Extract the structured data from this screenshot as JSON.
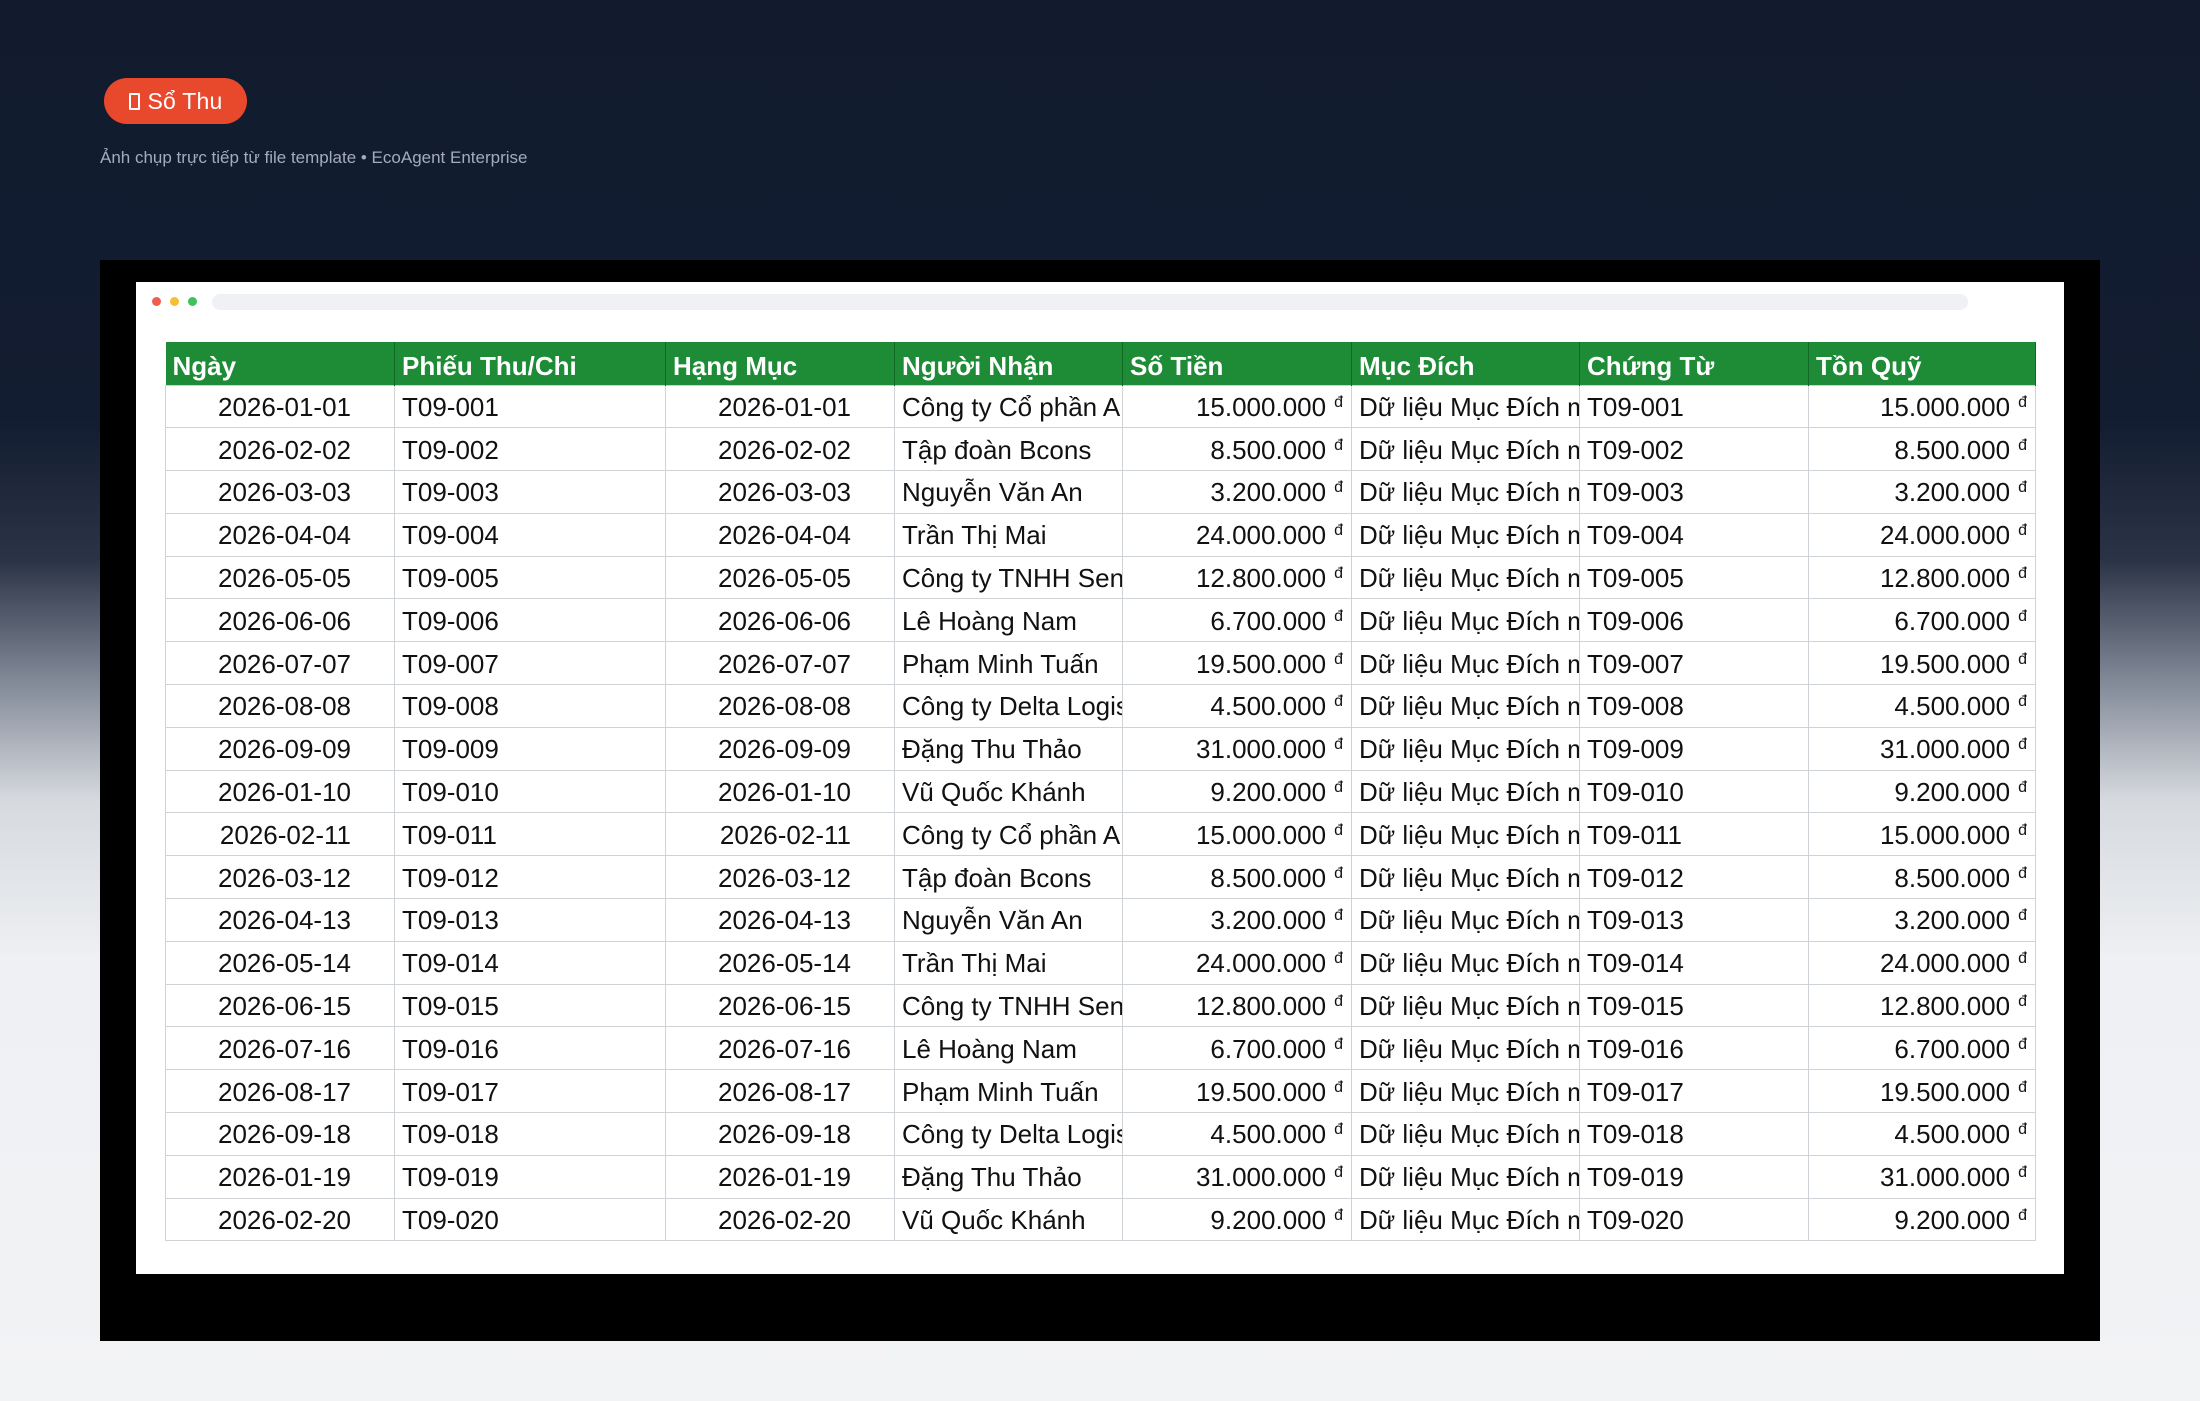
{
  "badge": {
    "icon": "book-icon",
    "label": "Sổ Thu"
  },
  "subtitle": "Ảnh chụp trực tiếp từ file template • EcoAgent Enterprise",
  "colors": {
    "badge": "#e8482c",
    "header": "#1e8b36",
    "frame": "#000000"
  },
  "table": {
    "currency_symbol": "đ",
    "headers": [
      "Ngày",
      "Phiếu Thu/Chi",
      "Hạng Mục",
      "Người Nhận",
      "Số Tiền",
      "Mục Đích",
      "Chứng Từ",
      "Tồn Quỹ"
    ],
    "rows": [
      [
        "2026-01-01",
        "T09-001",
        "2026-01-01",
        "Công ty Cổ phần A",
        "15.000.000",
        "Dữ liệu Mục Đích mẫu",
        "T09-001",
        "15.000.000"
      ],
      [
        "2026-02-02",
        "T09-002",
        "2026-02-02",
        "Tập đoàn Bcons",
        "8.500.000",
        "Dữ liệu Mục Đích mẫu",
        "T09-002",
        "8.500.000"
      ],
      [
        "2026-03-03",
        "T09-003",
        "2026-03-03",
        "Nguyễn Văn An",
        "3.200.000",
        "Dữ liệu Mục Đích mẫu",
        "T09-003",
        "3.200.000"
      ],
      [
        "2026-04-04",
        "T09-004",
        "2026-04-04",
        "Trần Thị Mai",
        "24.000.000",
        "Dữ liệu Mục Đích mẫu",
        "T09-004",
        "24.000.000"
      ],
      [
        "2026-05-05",
        "T09-005",
        "2026-05-05",
        "Công ty TNHH Sen",
        "12.800.000",
        "Dữ liệu Mục Đích mẫu",
        "T09-005",
        "12.800.000"
      ],
      [
        "2026-06-06",
        "T09-006",
        "2026-06-06",
        "Lê Hoàng Nam",
        "6.700.000",
        "Dữ liệu Mục Đích mẫu",
        "T09-006",
        "6.700.000"
      ],
      [
        "2026-07-07",
        "T09-007",
        "2026-07-07",
        "Phạm Minh Tuấn",
        "19.500.000",
        "Dữ liệu Mục Đích mẫu",
        "T09-007",
        "19.500.000"
      ],
      [
        "2026-08-08",
        "T09-008",
        "2026-08-08",
        "Công ty Delta Logistics",
        "4.500.000",
        "Dữ liệu Mục Đích mẫu",
        "T09-008",
        "4.500.000"
      ],
      [
        "2026-09-09",
        "T09-009",
        "2026-09-09",
        "Đặng Thu Thảo",
        "31.000.000",
        "Dữ liệu Mục Đích mẫu",
        "T09-009",
        "31.000.000"
      ],
      [
        "2026-01-10",
        "T09-010",
        "2026-01-10",
        "Vũ Quốc Khánh",
        "9.200.000",
        "Dữ liệu Mục Đích mẫu",
        "T09-010",
        "9.200.000"
      ],
      [
        "2026-02-11",
        "T09-011",
        "2026-02-11",
        "Công ty Cổ phần A",
        "15.000.000",
        "Dữ liệu Mục Đích mẫu",
        "T09-011",
        "15.000.000"
      ],
      [
        "2026-03-12",
        "T09-012",
        "2026-03-12",
        "Tập đoàn Bcons",
        "8.500.000",
        "Dữ liệu Mục Đích mẫu",
        "T09-012",
        "8.500.000"
      ],
      [
        "2026-04-13",
        "T09-013",
        "2026-04-13",
        "Nguyễn Văn An",
        "3.200.000",
        "Dữ liệu Mục Đích mẫu",
        "T09-013",
        "3.200.000"
      ],
      [
        "2026-05-14",
        "T09-014",
        "2026-05-14",
        "Trần Thị Mai",
        "24.000.000",
        "Dữ liệu Mục Đích mẫu",
        "T09-014",
        "24.000.000"
      ],
      [
        "2026-06-15",
        "T09-015",
        "2026-06-15",
        "Công ty TNHH Sen",
        "12.800.000",
        "Dữ liệu Mục Đích mẫu",
        "T09-015",
        "12.800.000"
      ],
      [
        "2026-07-16",
        "T09-016",
        "2026-07-16",
        "Lê Hoàng Nam",
        "6.700.000",
        "Dữ liệu Mục Đích mẫu",
        "T09-016",
        "6.700.000"
      ],
      [
        "2026-08-17",
        "T09-017",
        "2026-08-17",
        "Phạm Minh Tuấn",
        "19.500.000",
        "Dữ liệu Mục Đích mẫu",
        "T09-017",
        "19.500.000"
      ],
      [
        "2026-09-18",
        "T09-018",
        "2026-09-18",
        "Công ty Delta Logistics",
        "4.500.000",
        "Dữ liệu Mục Đích mẫu",
        "T09-018",
        "4.500.000"
      ],
      [
        "2026-01-19",
        "T09-019",
        "2026-01-19",
        "Đặng Thu Thảo",
        "31.000.000",
        "Dữ liệu Mục Đích mẫu",
        "T09-019",
        "31.000.000"
      ],
      [
        "2026-02-20",
        "T09-020",
        "2026-02-20",
        "Vũ Quốc Khánh",
        "9.200.000",
        "Dữ liệu Mục Đích mẫu",
        "T09-020",
        "9.200.000"
      ]
    ]
  }
}
